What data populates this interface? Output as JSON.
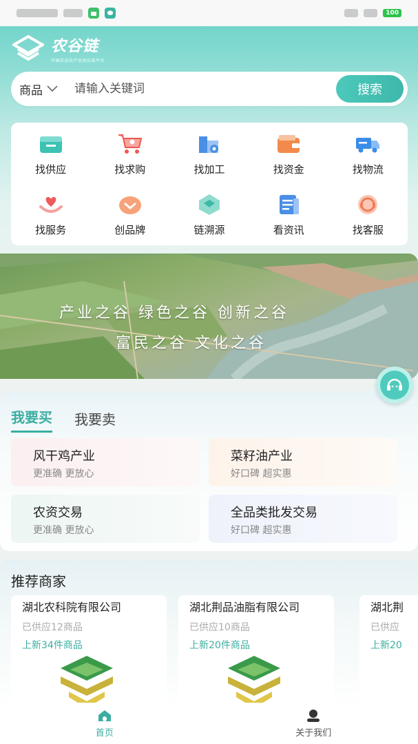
{
  "status_bar": {
    "battery": "100"
  },
  "brand": {
    "name": "农谷链",
    "tagline": "中国农谷农产品供应链平台"
  },
  "search": {
    "category": "商品",
    "placeholder": "请输入关键词",
    "button": "搜索"
  },
  "services": [
    {
      "label": "找供应",
      "icon": "supply-box-icon",
      "color": "#3cc3b3"
    },
    {
      "label": "找求购",
      "icon": "shopping-cart-icon",
      "color": "#ef5a4f"
    },
    {
      "label": "找加工",
      "icon": "factory-icon",
      "color": "#4a8fe6"
    },
    {
      "label": "找资金",
      "icon": "wallet-icon",
      "color": "#f28a4b"
    },
    {
      "label": "找物流",
      "icon": "truck-icon",
      "color": "#3a8de8"
    },
    {
      "label": "找服务",
      "icon": "heart-hand-icon",
      "color": "#ef6a6a"
    },
    {
      "label": "创品牌",
      "icon": "brand-badge-icon",
      "color": "#f38a56"
    },
    {
      "label": "链溯源",
      "icon": "trace-chain-icon",
      "color": "#4cc3b0"
    },
    {
      "label": "看资讯",
      "icon": "news-document-icon",
      "color": "#4a8fe6"
    },
    {
      "label": "找客服",
      "icon": "customer-service-icon",
      "color": "#f08a6a"
    }
  ],
  "banner": {
    "line1": "产业之谷 绿色之谷 创新之谷",
    "line2": "富民之谷 文化之谷"
  },
  "trade": {
    "tabs": [
      "我要买",
      "我要卖"
    ],
    "active_tab": "我要买",
    "items": [
      {
        "title": "风干鸡产业",
        "subtitle": "更准确 更放心"
      },
      {
        "title": "菜籽油产业",
        "subtitle": "好口碑 超实惠"
      },
      {
        "title": "农资交易",
        "subtitle": "更准确 更放心"
      },
      {
        "title": "全品类批发交易",
        "subtitle": "好口碑 超实惠"
      }
    ]
  },
  "recommend": {
    "title": "推荐商家",
    "merchants": [
      {
        "name": "湖北农科院有限公司",
        "supplied": "已供应12商品",
        "new": "上新34件商品"
      },
      {
        "name": "湖北荆品油脂有限公司",
        "supplied": "已供应10商品",
        "new": "上新20件商品"
      },
      {
        "name": "湖北荆",
        "supplied": "已供应",
        "new": "上新20"
      }
    ]
  },
  "nav": {
    "home": "首页",
    "about": "关于我们"
  },
  "colors": {
    "accent": "#3aaea1",
    "header_top": "#63d0c6"
  }
}
